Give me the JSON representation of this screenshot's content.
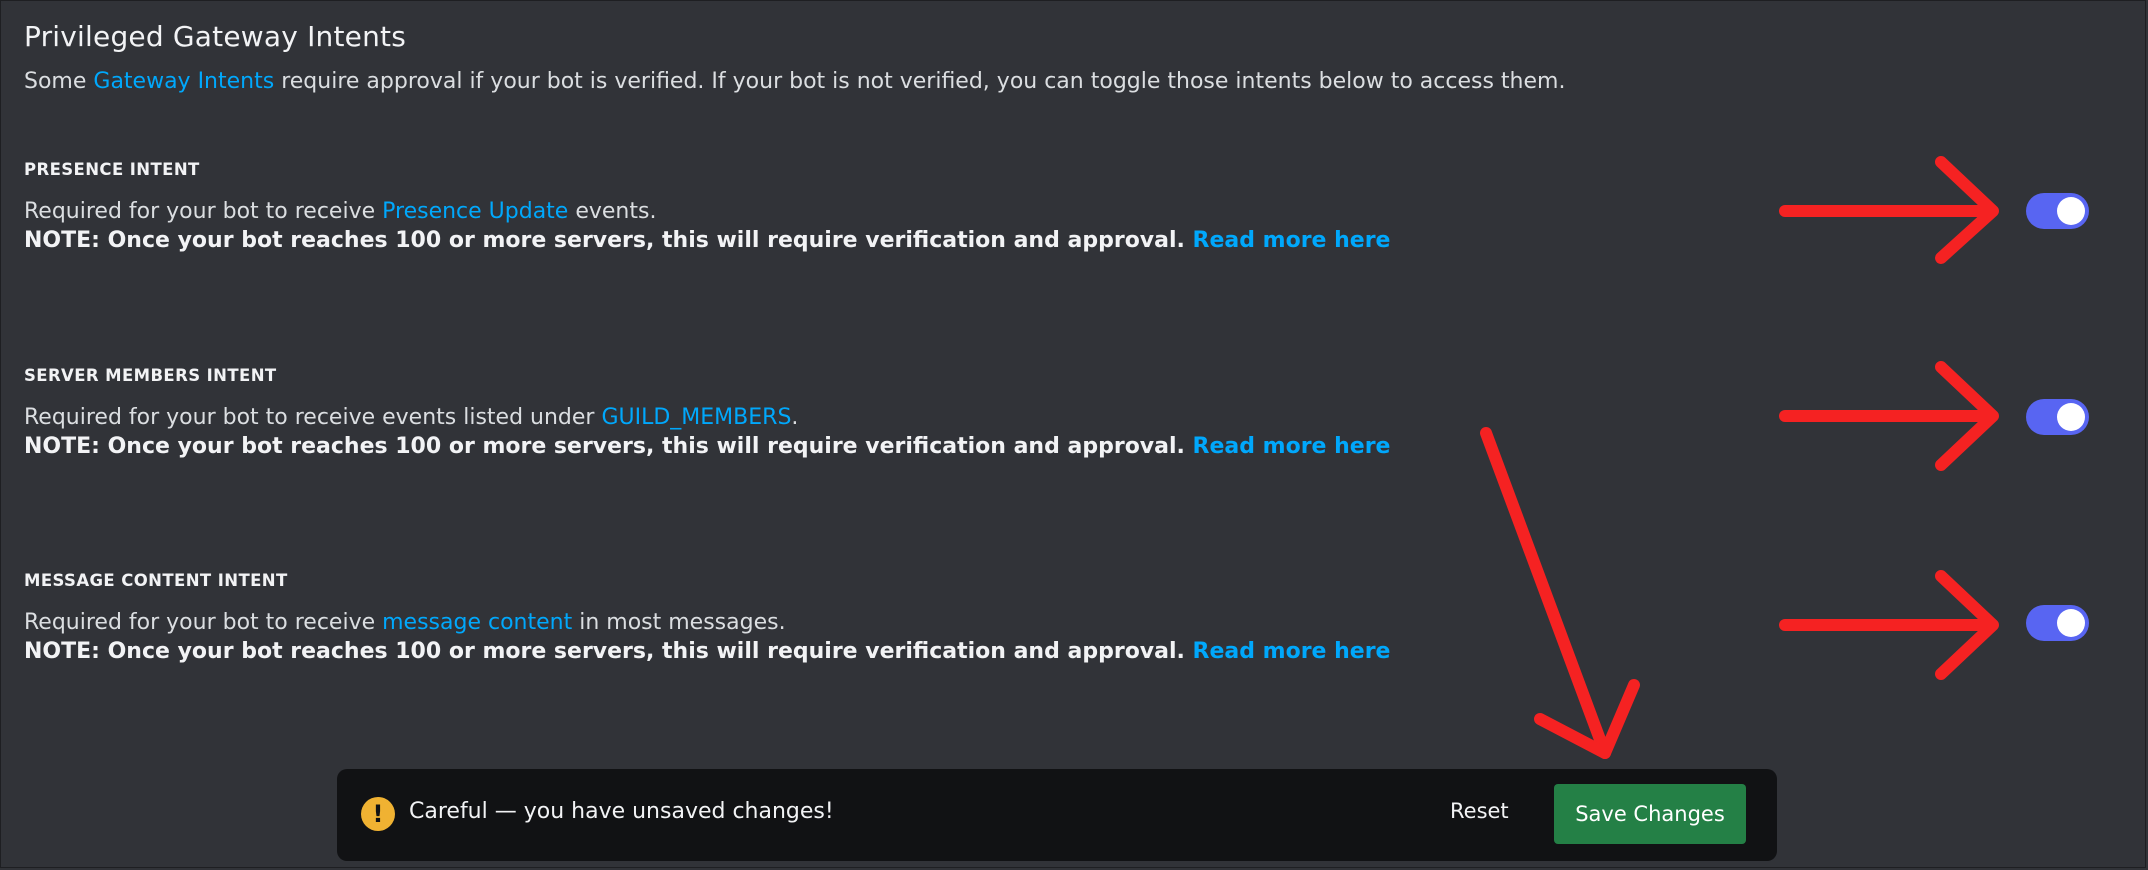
{
  "header": {
    "title": "Privileged Gateway Intents",
    "subtitle_prefix": "Some ",
    "subtitle_link": "Gateway Intents",
    "subtitle_suffix": " require approval if your bot is verified. If your bot is not verified, you can toggle those intents below to access them."
  },
  "intents": [
    {
      "heading": "PRESENCE INTENT",
      "desc_prefix": "Required for your bot to receive ",
      "desc_link": "Presence Update",
      "desc_suffix": " events.",
      "note": "NOTE: Once your bot reaches 100 or more servers, this will require verification and approval. ",
      "read_more": "Read more here",
      "enabled": true
    },
    {
      "heading": "SERVER MEMBERS INTENT",
      "desc_prefix": "Required for your bot to receive events listed under ",
      "desc_link": "GUILD_MEMBERS",
      "desc_suffix": ".",
      "note": "NOTE: Once your bot reaches 100 or more servers, this will require verification and approval. ",
      "read_more": "Read more here",
      "enabled": true
    },
    {
      "heading": "MESSAGE CONTENT INTENT",
      "desc_prefix": "Required for your bot to receive ",
      "desc_link": "message content",
      "desc_suffix": " in most messages.",
      "note": "NOTE: Once your bot reaches 100 or more servers, this will require verification and approval. ",
      "read_more": "Read more here",
      "enabled": true
    }
  ],
  "notice": {
    "icon": "exclamation-icon",
    "icon_glyph": "!",
    "text": "Careful — you have unsaved changes!",
    "reset_label": "Reset",
    "save_label": "Save Changes"
  },
  "colors": {
    "background": "#313338",
    "link": "#00a8fc",
    "toggle_on": "#5865f2",
    "save_button": "#248046",
    "warning": "#f0b232",
    "annotation_arrow": "#f52222"
  }
}
